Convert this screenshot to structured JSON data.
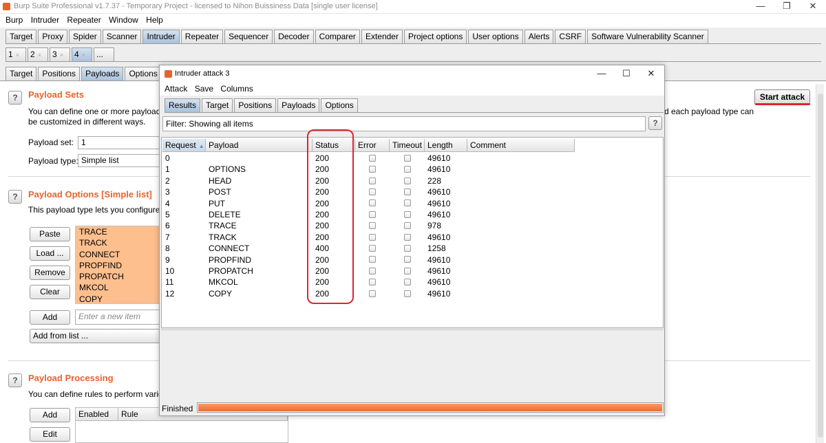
{
  "window": {
    "title": "Burp Suite Professional v1.7.37 - Temporary Project - licensed to Nihon Buissiness Data [single user license]",
    "controls": [
      "—",
      "❐",
      "✕"
    ]
  },
  "menu": [
    "Burp",
    "Intruder",
    "Repeater",
    "Window",
    "Help"
  ],
  "main_tabs": [
    {
      "label": "Target"
    },
    {
      "label": "Proxy"
    },
    {
      "label": "Spider"
    },
    {
      "label": "Scanner"
    },
    {
      "label": "Intruder",
      "active": true
    },
    {
      "label": "Repeater"
    },
    {
      "label": "Sequencer"
    },
    {
      "label": "Decoder"
    },
    {
      "label": "Comparer"
    },
    {
      "label": "Extender"
    },
    {
      "label": "Project options"
    },
    {
      "label": "User options"
    },
    {
      "label": "Alerts"
    },
    {
      "label": "CSRF"
    },
    {
      "label": "Software Vulnerability Scanner"
    }
  ],
  "attack_tabs": [
    {
      "label": "1",
      "close": "×"
    },
    {
      "label": "2",
      "close": "×"
    },
    {
      "label": "3",
      "close": "×"
    },
    {
      "label": "4",
      "close": "×",
      "active": true
    },
    {
      "label": "...",
      "close": ""
    }
  ],
  "sub_tabs": [
    {
      "label": "Target"
    },
    {
      "label": "Positions"
    },
    {
      "label": "Payloads",
      "active": true
    },
    {
      "label": "Options"
    }
  ],
  "payload_sets": {
    "title": "Payload Sets",
    "desc_left": "You can define one or more payload s",
    "desc_right": "d each payload type can",
    "desc_line2": "be customized in different ways.",
    "set_label": "Payload set:",
    "set_value": "1",
    "type_label": "Payload type:",
    "type_value": "Simple list"
  },
  "payload_options": {
    "title": "Payload Options [Simple list]",
    "desc": "This payload type lets you configure a",
    "buttons": {
      "paste": "Paste",
      "load": "Load ...",
      "remove": "Remove",
      "clear": "Clear",
      "add": "Add",
      "add_from_list": "Add from list ..."
    },
    "items": [
      "TRACE",
      "TRACK",
      "CONNECT",
      "PROPFIND",
      "PROPATCH",
      "MKCOL",
      "COPY"
    ],
    "new_item_placeholder": "Enter a new item"
  },
  "payload_processing": {
    "title": "Payload Processing",
    "desc": "You can define rules to perform variou",
    "buttons": {
      "add": "Add",
      "edit": "Edit"
    },
    "columns": [
      "Enabled",
      "Rule"
    ]
  },
  "start_attack": "Start attack",
  "help_glyph": "?",
  "dialog": {
    "title": "Intruder attack 3",
    "controls": [
      "—",
      "☐",
      "✕"
    ],
    "menu": [
      "Attack",
      "Save",
      "Columns"
    ],
    "tabs": [
      {
        "label": "Results",
        "active": true
      },
      {
        "label": "Target"
      },
      {
        "label": "Positions"
      },
      {
        "label": "Payloads"
      },
      {
        "label": "Options"
      }
    ],
    "filter": "Filter: Showing all items",
    "columns": [
      "Request",
      "Payload",
      "Status",
      "Error",
      "Timeout",
      "Length",
      "Comment"
    ],
    "sort_arrow": "▲",
    "rows": [
      {
        "request": "0",
        "payload": "",
        "status": "200",
        "length": "49610"
      },
      {
        "request": "1",
        "payload": "OPTIONS",
        "status": "200",
        "length": "49610"
      },
      {
        "request": "2",
        "payload": "HEAD",
        "status": "200",
        "length": "228"
      },
      {
        "request": "3",
        "payload": "POST",
        "status": "200",
        "length": "49610"
      },
      {
        "request": "4",
        "payload": "PUT",
        "status": "200",
        "length": "49610"
      },
      {
        "request": "5",
        "payload": "DELETE",
        "status": "200",
        "length": "49610"
      },
      {
        "request": "6",
        "payload": "TRACE",
        "status": "200",
        "length": "978"
      },
      {
        "request": "7",
        "payload": "TRACK",
        "status": "200",
        "length": "49610"
      },
      {
        "request": "8",
        "payload": "CONNECT",
        "status": "400",
        "length": "1258"
      },
      {
        "request": "9",
        "payload": "PROPFIND",
        "status": "200",
        "length": "49610"
      },
      {
        "request": "10",
        "payload": "PROPATCH",
        "status": "200",
        "length": "49610"
      },
      {
        "request": "11",
        "payload": "MKCOL",
        "status": "200",
        "length": "49610"
      },
      {
        "request": "12",
        "payload": "COPY",
        "status": "200",
        "length": "49610"
      }
    ],
    "status_text": "Finished",
    "progress": 1.0
  },
  "colors": {
    "accent": "#e8632c",
    "highlight": "#e0242c",
    "payload_list_bg": "#fdbf8e",
    "active_tab": "#a9c2dd"
  }
}
